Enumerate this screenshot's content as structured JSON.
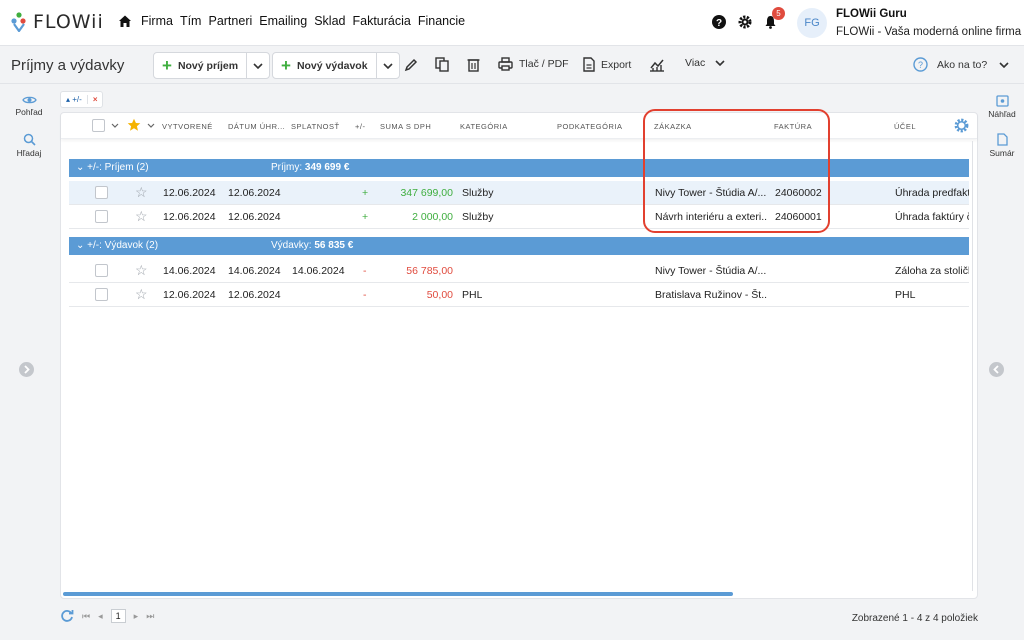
{
  "brand": {
    "name": "FLOWii"
  },
  "nav": {
    "items": [
      "Firma",
      "Tím",
      "Partneri",
      "Emailing",
      "Sklad",
      "Fakturácia",
      "Financie"
    ]
  },
  "notifications": {
    "count": "5"
  },
  "user": {
    "initials": "FG",
    "name": "FLOWii Guru",
    "subtitle": "FLOWii - Vaša moderná online firma"
  },
  "toolbar": {
    "title": "Príjmy a výdavky",
    "new_income": "Nový príjem",
    "new_expense": "Nový výdavok",
    "print": "Tlač / PDF",
    "export": "Export",
    "more": "Viac",
    "help": "Ako na to?"
  },
  "left_panel": {
    "view": "Pohľad",
    "search": "Hľadaj"
  },
  "right_panel": {
    "preview": "Náhľad",
    "summary": "Sumár"
  },
  "filter_chip": {
    "label": "+/-",
    "close": "×"
  },
  "columns": {
    "created": "Vytvorené",
    "paid": "Dátum úhr...",
    "due": "Splatnosť",
    "sign": "+/-",
    "amount": "Suma s DPH",
    "category": "Kategória",
    "subcategory": "Podkategória",
    "order": "Zákazka",
    "invoice": "Faktúra",
    "purpose": "Účel"
  },
  "groups": [
    {
      "title": "+/-: Príjem (2)",
      "sum_label": "Príjmy:",
      "sum_value": "349 699 €",
      "rows": [
        {
          "created": "12.06.2024",
          "paid": "12.06.2024",
          "due": "",
          "sign": "+",
          "amount": "347 699,00",
          "category": "Služby",
          "subcategory": "",
          "order": "Nivy Tower - Štúdia A/...",
          "invoice": "24060002",
          "purpose": "Úhrada predfaktú",
          "selected": true
        },
        {
          "created": "12.06.2024",
          "paid": "12.06.2024",
          "due": "",
          "sign": "+",
          "amount": "2 000,00",
          "category": "Služby",
          "subcategory": "",
          "order": "Návrh interiéru a exteri...",
          "invoice": "24060001",
          "purpose": "Úhrada faktúry č",
          "selected": false
        }
      ]
    },
    {
      "title": "+/-: Výdavok (2)",
      "sum_label": "Výdavky:",
      "sum_value": "56 835 €",
      "rows": [
        {
          "created": "14.06.2024",
          "paid": "14.06.2024",
          "due": "14.06.2024",
          "sign": "-",
          "amount": "56 785,00",
          "category": "",
          "subcategory": "",
          "order": "Nivy Tower - Štúdia A/...",
          "invoice": "",
          "purpose": "Záloha za stoličk",
          "selected": false
        },
        {
          "created": "12.06.2024",
          "paid": "12.06.2024",
          "due": "",
          "sign": "-",
          "amount": "50,00",
          "category": "PHL",
          "subcategory": "",
          "order": "Bratislava Ružinov - Št...",
          "invoice": "",
          "purpose": "PHL",
          "selected": false
        }
      ]
    }
  ],
  "pager": {
    "current_page": "1"
  },
  "footer": {
    "info": "Zobrazené 1 - 4 z 4 položiek"
  },
  "colors": {
    "accent": "#5b9bd5",
    "positive": "#3fae3f",
    "negative": "#e04b3e",
    "highlight": "#e2402f"
  }
}
